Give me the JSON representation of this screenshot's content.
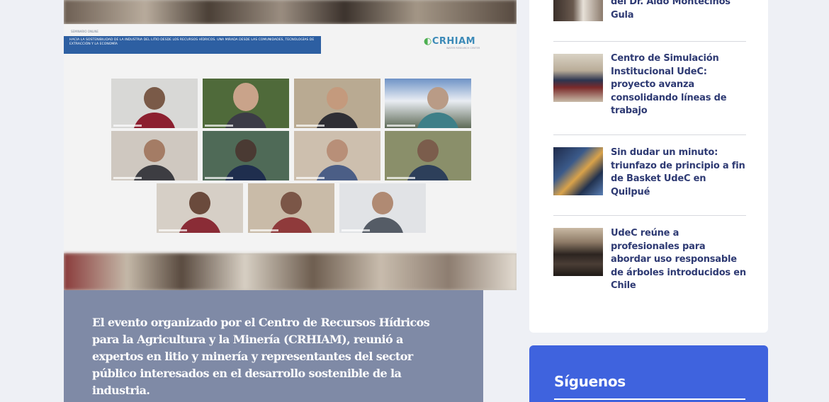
{
  "article": {
    "image_alt": "Videoconferencia del evento organizado por CRHIAM",
    "slide": {
      "header_small": "SEMINARIO ONLINE",
      "banner_text": "HACIA LA SOSTENIBILIDAD DE LA INDUSTRIA DEL LITIO DESDE LOS RECURSOS HÍDRICOS. UNA MIRADA DESDE LAS COMUNIDADES, TECNOLOGÍAS DE EXTRACCIÓN Y LA ECONOMÍA",
      "logo_text": "CRHIAM",
      "logo_sub": "WATER RESEARCH CENTER"
    },
    "caption": "El evento organizado por el Centro de Recursos Hídricos para la Agricultura y la Minería (CRHIAM), reunió a expertos en litio y minería y representantes del sector público interesados en el desarrollo sostenible de la industria."
  },
  "sidebar": {
    "news": [
      {
        "title": "del Dr. Aldo Montecinos Gula"
      },
      {
        "title": "Centro de Simulación Institucional UdeC: proyecto avanza consolidando líneas de trabajo"
      },
      {
        "title": "Sin dudar un minuto: triunfazo de principio a fin de Basket UdeC en Quilpué"
      },
      {
        "title": "UdeC reúne a profesionales para abordar uso responsable de árboles introducidos en Chile"
      }
    ],
    "follow": {
      "title": "Síguenos"
    }
  },
  "colors": {
    "background": "#eef0f5",
    "caption_bg": "#7f8aa6",
    "news_title": "#2e3a73",
    "follow_bg": "#3f63de",
    "banner": "#2d5fa2"
  }
}
